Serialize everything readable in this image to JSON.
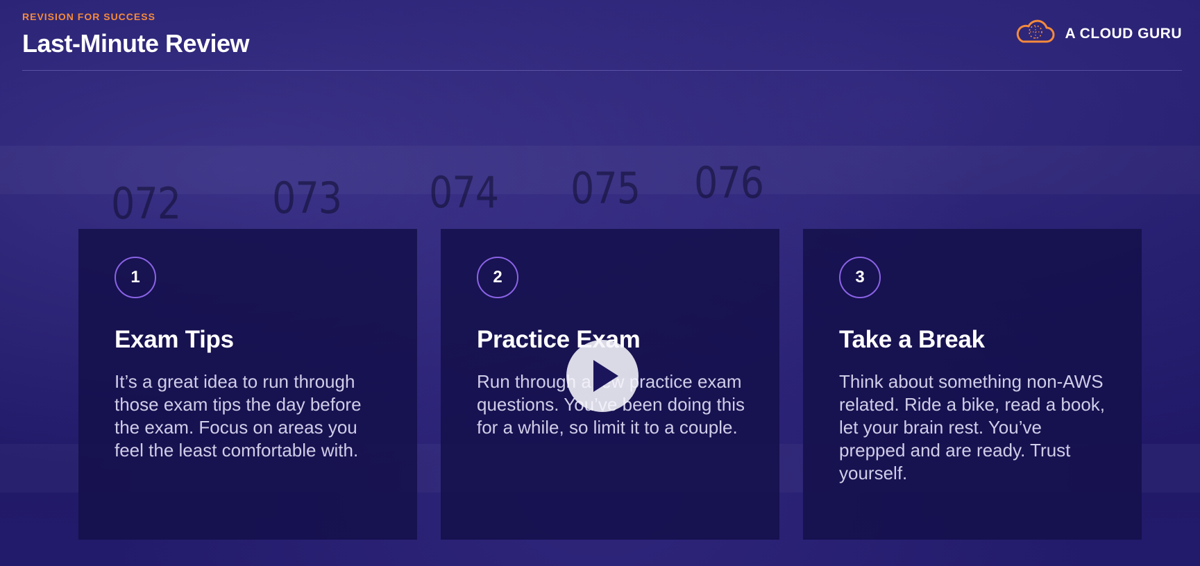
{
  "header": {
    "eyebrow": "REVISION FOR SUCCESS",
    "title": "Last-Minute Review"
  },
  "brand": {
    "name": "A CLOUD GURU",
    "logo_icon": "cloud-logo-icon",
    "logo_color": "#f58a3c"
  },
  "background_numbers": [
    "072",
    "073",
    "074",
    "075",
    "076"
  ],
  "cards": [
    {
      "number": "1",
      "title": "Exam Tips",
      "body": "It’s a great idea to run through those exam tips the day before the exam. Focus on areas you feel the least comfortable with."
    },
    {
      "number": "2",
      "title": "Practice Exam",
      "body": "Run through a few practice exam questions. You’ve been doing this for a while, so limit it to a couple."
    },
    {
      "number": "3",
      "title": "Take a Break",
      "body": "Think about something non-AWS related. Ride a bike, read a book, let your brain rest. You’ve prepped and are ready. Trust yourself."
    }
  ],
  "player": {
    "play_icon": "play-icon"
  },
  "colors": {
    "accent_orange": "#f58a3c",
    "accent_purple": "#8a63e6",
    "background": "#1f1866"
  }
}
